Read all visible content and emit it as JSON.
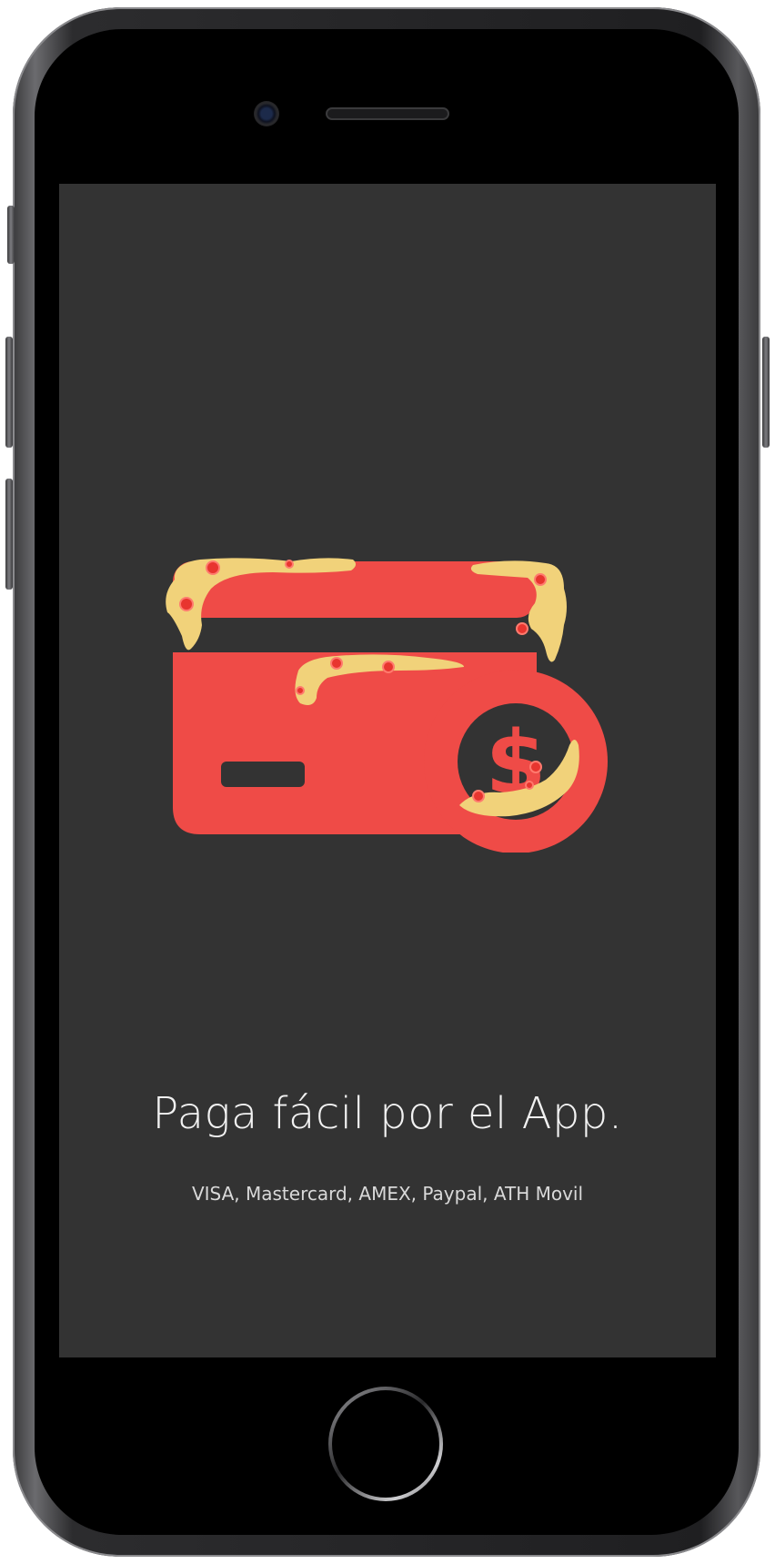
{
  "screen": {
    "background": "#333333",
    "illustration": {
      "icon": "credit-card-with-dollar-coin-and-melted-cheese",
      "card_color": "#EF4B47",
      "stripe_color": "#333333",
      "cheese_color": "#F1D27A",
      "pepperoni_color": "#E8352F",
      "dollar_symbol": "$"
    },
    "headline": "Paga fácil por el App.",
    "payment_methods": "VISA, Mastercard, AMEX, Paypal, ATH Movil"
  }
}
